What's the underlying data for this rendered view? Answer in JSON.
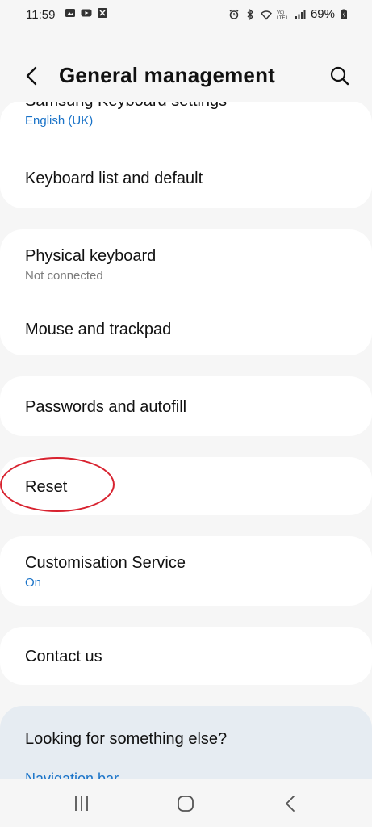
{
  "status": {
    "time": "11:59",
    "battery": "69%",
    "left_icons": [
      "gallery-icon",
      "youtube-icon",
      "app-icon"
    ],
    "right_icons": [
      "alarm-icon",
      "bluetooth-icon",
      "wifi-icon",
      "volte-icon",
      "signal-icon",
      "battery-icon"
    ]
  },
  "header": {
    "title": "General management"
  },
  "groups": [
    {
      "items": [
        {
          "title": "Samsung Keyboard settings",
          "subtitle": "English (UK)",
          "subtitle_color": "blue"
        },
        {
          "title": "Keyboard list and default",
          "subtitle": ""
        }
      ]
    },
    {
      "items": [
        {
          "title": "Physical keyboard",
          "subtitle": "Not connected",
          "subtitle_color": "grey"
        },
        {
          "title": "Mouse and trackpad",
          "subtitle": ""
        }
      ]
    },
    {
      "items": [
        {
          "title": "Passwords and autofill",
          "subtitle": ""
        }
      ]
    },
    {
      "items": [
        {
          "title": "Reset",
          "subtitle": ""
        }
      ]
    },
    {
      "items": [
        {
          "title": "Customisation Service",
          "subtitle": "On",
          "subtitle_color": "blue"
        }
      ]
    },
    {
      "items": [
        {
          "title": "Contact us",
          "subtitle": ""
        }
      ]
    }
  ],
  "looking": {
    "title": "Looking for something else?",
    "link": "Navigation bar"
  },
  "annotation": {
    "highlighted_item": "Reset",
    "color": "#d8222f"
  },
  "colors": {
    "accent_blue": "#1a73c8",
    "background": "#f6f6f6",
    "card": "#ffffff",
    "suggestion_card": "#e6ecf2"
  },
  "nav": {
    "buttons": [
      "recents-icon",
      "home-icon",
      "back-icon"
    ]
  }
}
